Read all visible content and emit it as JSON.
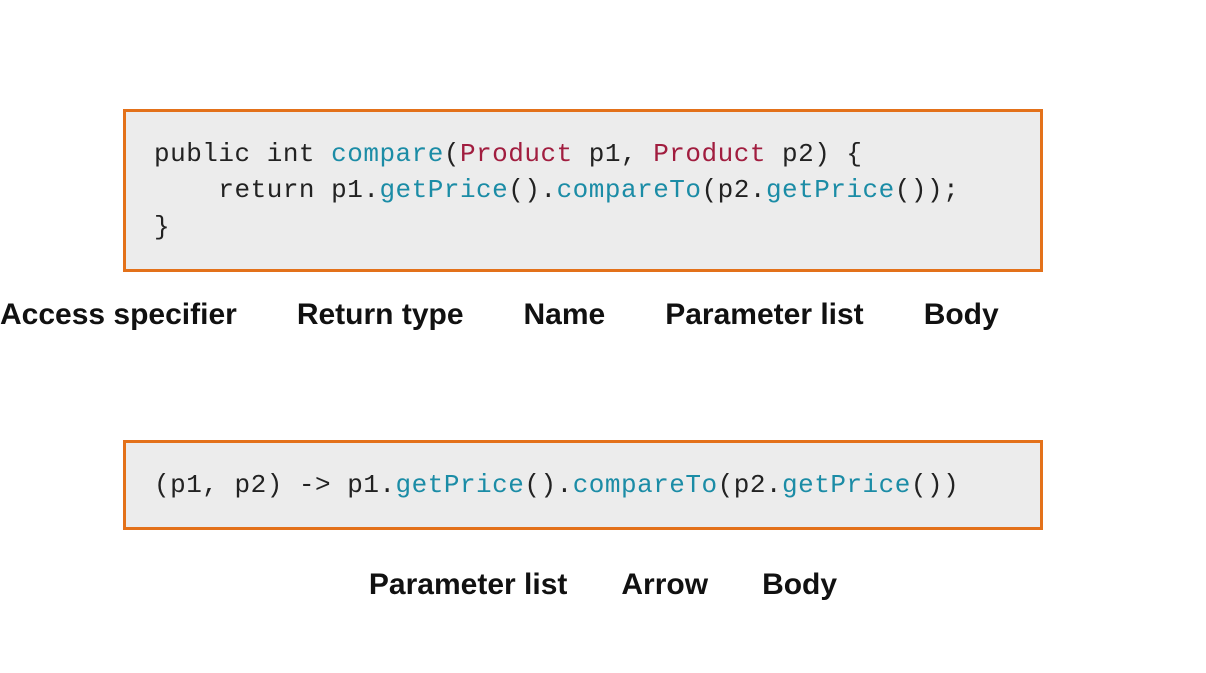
{
  "code1": {
    "tokens": [
      {
        "t": "public int ",
        "c": "kw"
      },
      {
        "t": "compare",
        "c": "fn"
      },
      {
        "t": "(",
        "c": "kw"
      },
      {
        "t": "Product",
        "c": "type"
      },
      {
        "t": " p1, ",
        "c": "kw"
      },
      {
        "t": "Product",
        "c": "type"
      },
      {
        "t": " p2) {\n    return p1.",
        "c": "kw"
      },
      {
        "t": "getPrice",
        "c": "fn"
      },
      {
        "t": "().",
        "c": "kw"
      },
      {
        "t": "compareTo",
        "c": "fn"
      },
      {
        "t": "(p2.",
        "c": "kw"
      },
      {
        "t": "getPrice",
        "c": "fn"
      },
      {
        "t": "());\n}",
        "c": "kw"
      }
    ]
  },
  "code2": {
    "tokens": [
      {
        "t": "(p1, p2) -> p1.",
        "c": "kw"
      },
      {
        "t": "getPrice",
        "c": "fn"
      },
      {
        "t": "().",
        "c": "kw"
      },
      {
        "t": "compareTo",
        "c": "fn"
      },
      {
        "t": "(p2.",
        "c": "kw"
      },
      {
        "t": "getPrice",
        "c": "fn"
      },
      {
        "t": "())",
        "c": "kw"
      }
    ]
  },
  "labels1": {
    "l0": "Access specifier",
    "l1": "Return type",
    "l2": "Name",
    "l3": "Parameter list",
    "l4": "Body"
  },
  "labels2": {
    "l0": "Parameter list",
    "l1": "Arrow",
    "l2": "Body"
  }
}
